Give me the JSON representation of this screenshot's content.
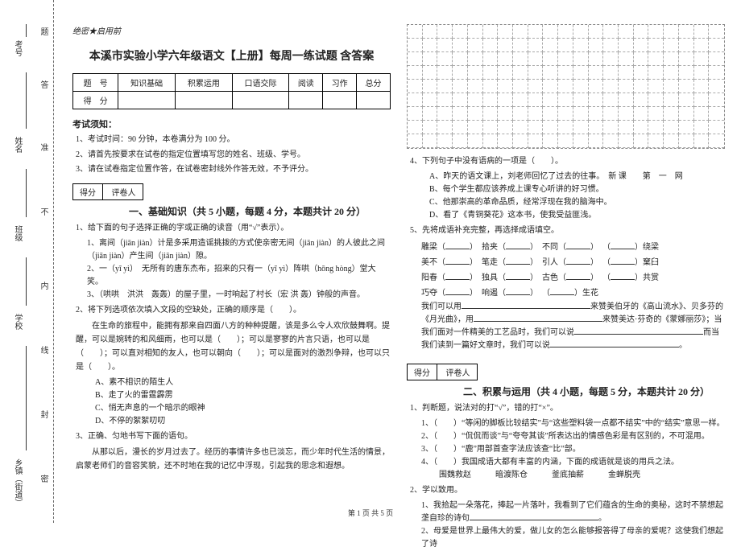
{
  "secret": "绝密★启用前",
  "title": "本溪市实验小学六年级语文【上册】每周一练试题 含答案",
  "score_table": {
    "hdr": "题　号",
    "cols": [
      "知识基础",
      "积累运用",
      "口语交际",
      "阅读",
      "习作",
      "总分"
    ],
    "row": "得　分"
  },
  "notice_hdr": "考试须知：",
  "notices": [
    "1、考试时间：90 分钟，本卷满分为 100 分。",
    "2、请首先按要求在试卷的指定位置填写您的姓名、班级、学号。",
    "3、请在试卷指定位置作答，在试卷密封线外作答无效，不予评分。"
  ],
  "scorebox": {
    "a": "得分",
    "b": "评卷人"
  },
  "part1": "一、基础知识（共 5 小题，每题 4 分，本题共计 20 分）",
  "q1": "1、给下面的句子选择正确的字或正确的读音（用“√”表示）。",
  "q1a": "1、离间（jiān  jiàn）计是多采用造谣挑拨的方式使亲密无间（jiān  jiàn）的人彼此之间（jiān  jiàn）产生间（jiān  jiàn）隙。",
  "q1b": "2、一（yī yì）　无所有的唐东杰布，招来的只有一（yī yì）阵哄（hōng hòng）堂大笑。",
  "q1c": "3、（哄哄　洪洪　轰轰）的屋子里，一时响起了村长（宏 洪 轰）钟般的声音。",
  "q2": "2、将下列选项依次填入文段的空缺处，正确的顺序是（　　）。",
  "q2p": "在生命的旅程中，能拥有那来自四面八方的种种提醒，该是多么令人欢欣鼓舞啊。提醒，可以是婉转的和风细雨，也可以是（　　）；可以是寥寥的片言只语，也可以是（　　）；可以直对相知的友人，也可以朝向（　　）；可以是面对的激烈争辩，也可以只是（　　）。",
  "q2a": "A、素不相识的陌生人",
  "q2b": "B、走了火的雷霆霹雳",
  "q2c": "C、悄无声息的一个暗示的眼神",
  "q2d": "D、不停的絮絮叨叨",
  "q3": "3、正确、匀地书写下面的语句。",
  "q3p": "从那以后，漫长的岁月过去了。经历的事情许多也已淡忘，而少年时代生活的情景，启蒙老师们的音容笑貌，还不时地在我的记忆中浮现，引起我的思念和遐想。",
  "q4": "4、下列句子中没有语病的一项是（　　）。",
  "q4a": "A、昨天的语文课上，刘老师回忆了过去的往事。　新 课　　第　一　网",
  "q4b": "B、每个学生都应该养成上课专心听讲的好习惯。",
  "q4c": "C、他那崇高的革命品质，经常浮现在我的脑海中。",
  "q4d": "D、看了《青铜葵花》这本书，使我受益匪浅。",
  "q5": "5、先将成语补充完整，再选择成语填空。",
  "q5rows": [
    [
      "雕梁（",
      "）",
      "拾夹（",
      "）",
      "不同（",
      "）",
      "（",
      "）绕梁"
    ],
    [
      "美不（",
      "）",
      "笔走（",
      "）",
      "引人（",
      "）",
      "（",
      "）窠臼"
    ],
    [
      "阳春（",
      "）",
      "独具（",
      "）",
      "古色（",
      "）",
      "（",
      "）共赏"
    ],
    [
      "巧夺（",
      "）",
      "响遏（",
      "）",
      "（",
      "）生花",
      "",
      ""
    ]
  ],
  "q5p1": "我们可以用________________________来赞美伯牙的《高山流水》、贝多芬的《月光曲》，用________________________来赞美达·芬奇的《蒙娜丽莎》；当我们面对一件精美的工艺品时，我们可以说________________________而当我们读到一篇好文章时，我们可以说________________________。",
  "part2": "二、积累与运用（共 4 小题，每题 5 分，本题共计 20 分）",
  "q21": "1、判断题，说法对的打“√”，错的打“×”。",
  "q21a": "1、（　　）“等闲的脚板比较结实”与“这些塑料袋一点都不结实”中的“结实”意思一样。",
  "q21b": "2、（　　）“侃侃而谈”与“夸夸其谈”所表达出的情感色彩是有区别的，不可混用。",
  "q21c": "3、（　　）“鹿”用部首查字法应该查“比”部。",
  "q21d": "4、（　　）我国成语大都有丰富的内涵，下面的成语就是谈的用兵之法。",
  "q21e": "围魏救赵　　　暗渡陈仓　　　釜底抽薪　　　金蝉脱壳",
  "q22": "2、学以致用。",
  "q22a": "1、我拾起一朵落花，捧起一片落叶，我看到了它们蕴含的生命的奥秘，这时不禁想起垄自珍的诗句________________________。",
  "q22b": "2、母爱是世界上最伟大的爱，做儿女的怎么能够报答得了母亲的爱呢？这使我们想起了诗",
  "footer": "第 1 页 共 5 页",
  "bind": {
    "f1": "考号",
    "f2": "姓名",
    "f3": "班级",
    "f4": "学校",
    "f5": "乡镇（街道）",
    "c1": "题",
    "c2": "答",
    "c3": "准",
    "c4": "不",
    "c5": "内",
    "c6": "线",
    "c7": "封",
    "c8": "密"
  }
}
